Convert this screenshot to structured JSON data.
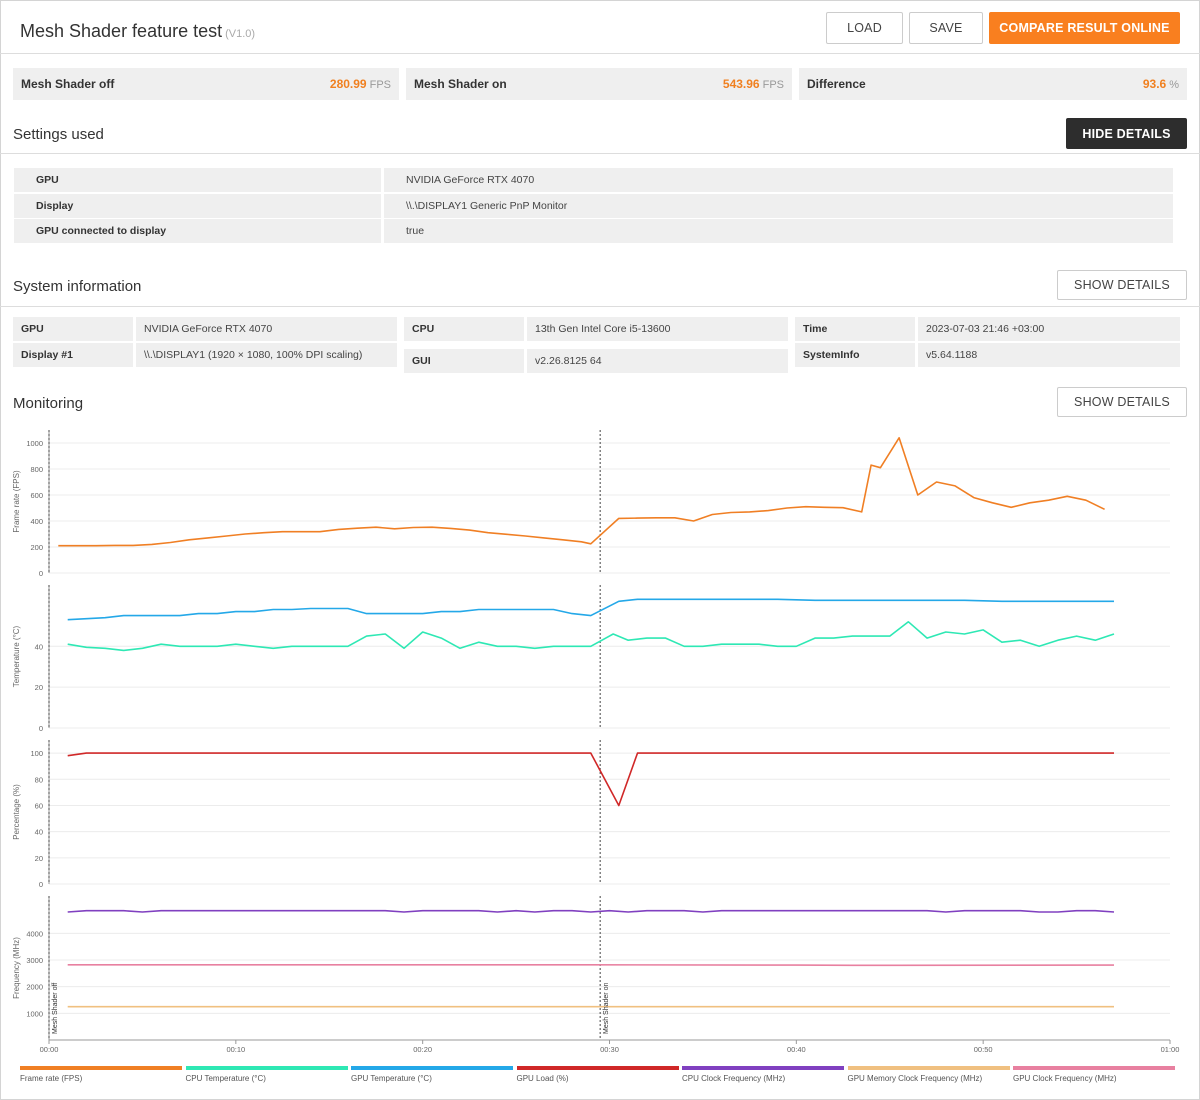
{
  "header": {
    "title": "Mesh Shader feature test",
    "version": "(V1.0)",
    "load_label": "LOAD",
    "save_label": "SAVE",
    "compare_label": "COMPARE RESULT ONLINE"
  },
  "scores": [
    {
      "label": "Mesh Shader off",
      "value": "280.99",
      "unit": "FPS"
    },
    {
      "label": "Mesh Shader on",
      "value": "543.96",
      "unit": "FPS"
    },
    {
      "label": "Difference",
      "value": "93.6",
      "unit": "%"
    }
  ],
  "settings": {
    "title": "Settings used",
    "button": "HIDE DETAILS",
    "rows": [
      {
        "k": "GPU",
        "v": "NVIDIA GeForce RTX 4070"
      },
      {
        "k": "Display",
        "v": "\\\\.\\DISPLAY1 Generic PnP Monitor"
      },
      {
        "k": "GPU connected to display",
        "v": "true"
      }
    ]
  },
  "system": {
    "title": "System information",
    "button": "SHOW DETAILS",
    "col1": [
      {
        "k": "GPU",
        "v": "NVIDIA GeForce RTX 4070"
      },
      {
        "k": "Display #1",
        "v": "\\\\.\\DISPLAY1 (1920 × 1080, 100% DPI scaling)"
      }
    ],
    "col2": [
      {
        "k": "CPU",
        "v": "13th Gen Intel Core i5-13600"
      },
      {
        "k": "GUI",
        "v": "v2.26.8125 64"
      }
    ],
    "col3": [
      {
        "k": "Time",
        "v": "2023-07-03 21:46 +03:00"
      },
      {
        "k": "SystemInfo",
        "v": "v5.64.1188"
      }
    ]
  },
  "monitoring": {
    "title": "Monitoring",
    "button": "SHOW DETAILS",
    "markers": [
      "Mesh Shader off",
      "Mesh Shader on"
    ],
    "legend": [
      {
        "label": "Frame rate (FPS)",
        "color": "#f07f24"
      },
      {
        "label": "CPU Temperature (°C)",
        "color": "#2ee8b4"
      },
      {
        "label": "GPU Temperature (°C)",
        "color": "#24a8e8"
      },
      {
        "label": "GPU Load (%)",
        "color": "#d02828"
      },
      {
        "label": "CPU Clock Frequency (MHz)",
        "color": "#8040c0"
      },
      {
        "label": "GPU Memory Clock Frequency (MHz)",
        "color": "#f0c080"
      },
      {
        "label": "GPU Clock Frequency (MHz)",
        "color": "#e880a0"
      }
    ]
  },
  "chart_data": [
    {
      "type": "line",
      "ylabel": "Frame rate (FPS)",
      "yticks": [
        0,
        200,
        400,
        600,
        800,
        1000
      ],
      "ylim": [
        0,
        1100
      ],
      "series": [
        {
          "name": "Frame rate (FPS)",
          "color": "#f07f24",
          "x": [
            0.5,
            1.5,
            2.5,
            3.5,
            4.5,
            5.5,
            6.5,
            7.5,
            8.5,
            9.5,
            10.5,
            11.5,
            12.5,
            13.5,
            14.5,
            15.5,
            16.5,
            17.5,
            18.5,
            19.5,
            20.5,
            21.5,
            22.5,
            23.5,
            24.5,
            25.5,
            26.5,
            27.5,
            28.5,
            29.0,
            30.5,
            31.5,
            32.5,
            33.5,
            34.5,
            35.5,
            36.5,
            37.5,
            38.5,
            39.5,
            40.5,
            41.5,
            42.5,
            43.5,
            44.0,
            44.5,
            45.5,
            46.5,
            47.5,
            48.5,
            49.5,
            50.5,
            51.5,
            52.5,
            53.5,
            54.5,
            55.5,
            56.5
          ],
          "y": [
            210,
            210,
            210,
            212,
            212,
            220,
            235,
            255,
            270,
            285,
            300,
            310,
            318,
            318,
            318,
            335,
            345,
            352,
            340,
            350,
            352,
            343,
            330,
            310,
            298,
            285,
            270,
            255,
            240,
            225,
            420,
            422,
            425,
            425,
            400,
            450,
            465,
            470,
            480,
            500,
            510,
            505,
            502,
            470,
            830,
            810,
            1040,
            600,
            700,
            670,
            580,
            540,
            505,
            540,
            560,
            590,
            560,
            490
          ]
        }
      ],
      "xticks": [
        "00:00",
        "00:10",
        "00:20",
        "00:30",
        "00:40",
        "00:50",
        "01:00"
      ],
      "xlim": [
        0,
        60
      ]
    },
    {
      "type": "line",
      "ylabel": "Temperature (°C)",
      "yticks": [
        0,
        20,
        40
      ],
      "ylim": [
        0,
        70
      ],
      "series": [
        {
          "name": "GPU Temperature (°C)",
          "color": "#24a8e8",
          "x": [
            1,
            2,
            3,
            4,
            5,
            6,
            7,
            8,
            9,
            10,
            11,
            12,
            13,
            14,
            15,
            16,
            17,
            18,
            19,
            20,
            21,
            22,
            23,
            24,
            25,
            26,
            27,
            28,
            29.0,
            30.5,
            31.5,
            33,
            35,
            37,
            39,
            41,
            43,
            45,
            47,
            49,
            51,
            53,
            55,
            57
          ],
          "y": [
            53,
            53.5,
            54,
            55,
            55,
            55,
            55,
            56,
            56,
            57,
            57,
            58,
            58,
            58.5,
            58.5,
            58.5,
            56,
            56,
            56,
            56,
            57,
            57,
            58,
            58,
            58,
            58,
            58,
            56,
            55,
            62,
            63,
            63,
            63,
            63,
            63,
            62.5,
            62.5,
            62.5,
            62.5,
            62.5,
            62,
            62,
            62,
            62
          ]
        },
        {
          "name": "CPU Temperature (°C)",
          "color": "#2ee8b4",
          "x": [
            1,
            2,
            3,
            4,
            5,
            6,
            7,
            8,
            9,
            10,
            11,
            12,
            13,
            14,
            15,
            16,
            17,
            18,
            19,
            20,
            21,
            22,
            23,
            24,
            25,
            26,
            27,
            28,
            29.0,
            30.2,
            31.0,
            32,
            33,
            34,
            35,
            36,
            37,
            38,
            39,
            40,
            41,
            42,
            43,
            44,
            45,
            46,
            47,
            48,
            49,
            50,
            51,
            52,
            53,
            54,
            55,
            56,
            57
          ],
          "y": [
            41,
            39.5,
            39,
            38,
            39,
            41,
            40,
            40,
            40,
            41,
            40,
            39,
            40,
            40,
            40,
            40,
            45,
            46,
            39,
            47,
            44,
            39,
            42,
            40,
            40,
            39,
            40,
            40,
            40,
            46,
            43,
            44,
            44,
            40,
            40,
            41,
            41,
            41,
            40,
            40,
            44,
            44,
            45,
            45,
            45,
            52,
            44,
            47,
            46,
            48,
            42,
            43,
            40,
            43,
            45,
            43,
            46
          ]
        }
      ]
    },
    {
      "type": "line",
      "ylabel": "Percentage (%)",
      "yticks": [
        0,
        20,
        40,
        60,
        80,
        100
      ],
      "ylim": [
        0,
        110
      ],
      "series": [
        {
          "name": "GPU Load (%)",
          "color": "#d02828",
          "x": [
            1,
            2,
            29.0,
            30.5,
            31.5,
            57
          ],
          "y": [
            98,
            100,
            100,
            60,
            100,
            100
          ]
        }
      ]
    },
    {
      "type": "line",
      "ylabel": "Frequency (MHz)",
      "yticks": [
        1000,
        2000,
        3000,
        4000
      ],
      "ylim": [
        0,
        5400
      ],
      "series": [
        {
          "name": "CPU Clock Frequency (MHz)",
          "color": "#8040c0",
          "x": [
            1,
            2,
            3,
            4,
            5,
            6,
            7,
            8,
            9,
            10,
            11,
            12,
            13,
            14,
            15,
            16,
            17,
            18,
            19,
            20,
            21,
            22,
            23,
            24,
            25,
            26,
            27,
            28,
            29,
            30,
            31,
            32,
            33,
            34,
            35,
            36,
            37,
            38,
            39,
            40,
            41,
            42,
            43,
            44,
            45,
            46,
            47,
            48,
            49,
            50,
            51,
            52,
            53,
            54,
            55,
            56,
            57
          ],
          "y": [
            4800,
            4850,
            4850,
            4850,
            4800,
            4850,
            4850,
            4850,
            4850,
            4850,
            4850,
            4850,
            4850,
            4850,
            4850,
            4850,
            4850,
            4850,
            4800,
            4850,
            4850,
            4850,
            4850,
            4800,
            4850,
            4800,
            4850,
            4850,
            4800,
            4850,
            4800,
            4850,
            4850,
            4850,
            4800,
            4850,
            4850,
            4850,
            4850,
            4850,
            4850,
            4850,
            4850,
            4850,
            4850,
            4850,
            4850,
            4800,
            4850,
            4850,
            4850,
            4850,
            4800,
            4800,
            4850,
            4850,
            4800
          ]
        },
        {
          "name": "GPU Clock Frequency (MHz)",
          "color": "#e880a0",
          "x": [
            1,
            29,
            40,
            43,
            57
          ],
          "y": [
            2820,
            2820,
            2810,
            2800,
            2810
          ]
        },
        {
          "name": "GPU Memory Clock Frequency (MHz)",
          "color": "#f0c080",
          "x": [
            1,
            57
          ],
          "y": [
            1250,
            1250
          ]
        }
      ]
    }
  ]
}
